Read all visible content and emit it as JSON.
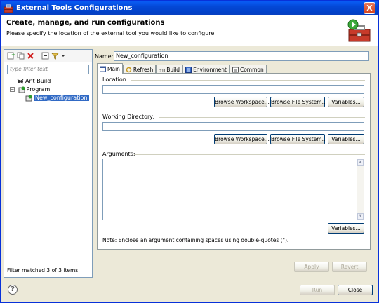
{
  "window": {
    "title": "External Tools Configurations",
    "close_label": "X"
  },
  "banner": {
    "title": "Create, manage, and run configurations",
    "message": "Please specify the location of the external tool you would like to configure."
  },
  "left": {
    "filter_placeholder": "type filter text",
    "tree": [
      {
        "label": "Ant Build",
        "level": 1,
        "icon": "ant-icon"
      },
      {
        "label": "Program",
        "level": 1,
        "expanded": true,
        "icon": "program-icon"
      },
      {
        "label": "New_configuration",
        "level": 2,
        "selected": true,
        "icon": "config-icon"
      }
    ],
    "status": "Filter matched 3 of 3 items"
  },
  "right": {
    "name_label": "Name:",
    "name_value": "New_configuration",
    "tabs": [
      {
        "label": "Main",
        "active": true,
        "icon": "main-icon"
      },
      {
        "label": "Refresh",
        "icon": "refresh-icon"
      },
      {
        "label": "Build",
        "icon": "build-icon"
      },
      {
        "label": "Environment",
        "icon": "environment-icon"
      },
      {
        "label": "Common",
        "icon": "common-icon"
      }
    ],
    "location": {
      "label": "Location:",
      "value": "",
      "browse_workspace": "Browse Workspace...",
      "browse_fs": "Browse File System...",
      "variables": "Variables..."
    },
    "working_dir": {
      "label": "Working Directory:",
      "value": "",
      "browse_workspace": "Browse Workspace...",
      "browse_fs": "Browse File System...",
      "variables": "Variables..."
    },
    "arguments": {
      "label": "Arguments:",
      "value": "",
      "variables": "Variables...",
      "note": "Note: Enclose an argument containing spaces using double-quotes (\")."
    },
    "apply": "Apply",
    "revert": "Revert"
  },
  "footer": {
    "run": "Run",
    "close": "Close"
  },
  "colors": {
    "title_bar": "#0448d6",
    "selection": "#316ac5",
    "dialog_bg": "#ece9d8"
  }
}
